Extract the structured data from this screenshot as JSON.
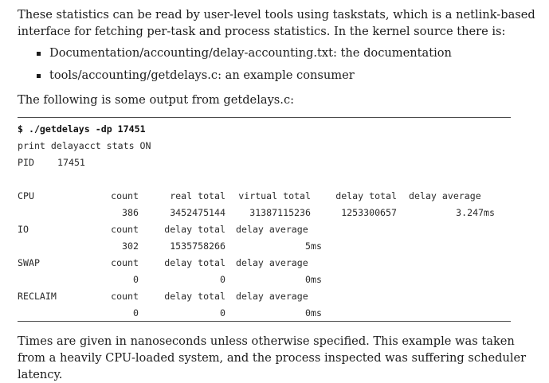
{
  "intro": "These statistics can be read by user-level tools using taskstats, which is a netlink-based interface for fetching per-task and process statistics. In the kernel source there is:",
  "bullets": [
    "Documentation/accounting/delay-accounting.txt: the documentation",
    "tools/accounting/getdelays.c: an example consumer"
  ],
  "lead_in": "The following is some output from getdelays.c:",
  "code": {
    "prompt": "$ ",
    "command": "./getdelays -dp 17451",
    "line2": "print delayacct stats ON",
    "pid_label": "PID",
    "pid_value": "17451",
    "cpu": {
      "label": "CPU",
      "headers": [
        "count",
        "real total",
        "virtual total",
        "delay total",
        "delay average"
      ],
      "values": [
        "386",
        "3452475144",
        "31387115236",
        "1253300657",
        "3.247ms"
      ]
    },
    "io": {
      "label": "IO",
      "headers": [
        "count",
        "delay total",
        "delay average"
      ],
      "values": [
        "302",
        "1535758266",
        "5ms"
      ]
    },
    "swap": {
      "label": "SWAP",
      "headers": [
        "count",
        "delay total",
        "delay average"
      ],
      "values": [
        "0",
        "0",
        "0ms"
      ]
    },
    "reclaim": {
      "label": "RECLAIM",
      "headers": [
        "count",
        "delay total",
        "delay average"
      ],
      "values": [
        "0",
        "0",
        "0ms"
      ]
    }
  },
  "closing": "Times are given in nanoseconds unless otherwise specified. This example was taken from a heavily CPU-loaded system, and the process inspected was suffering scheduler latency."
}
